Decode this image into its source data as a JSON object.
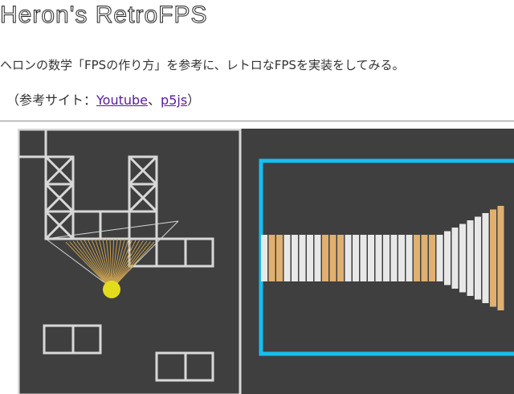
{
  "page": {
    "title": "Heron's RetroFPS",
    "description": "ヘロンの数学「FPSの作り方」を参考に、レトロなFPSを実装をしてみる。",
    "refs_prefix": "（参考サイト：",
    "refs_link1": "Youtube",
    "refs_sep": "、",
    "refs_link2": "p5js",
    "refs_suffix": "）"
  },
  "colors": {
    "background": "#ffffff",
    "canvas": "#3f3f3f",
    "wall": "#d8d8d8",
    "player": "#e2dc1c",
    "rays": "#c8a050",
    "wall_shade": "#e8e8e8",
    "wall_accent": "#e0b070",
    "viewport_border": "#14bff0",
    "link": "#5a1a9e"
  },
  "map": {
    "player_icon": "player-dot"
  },
  "view3d": {
    "strips": [
      "gray",
      "tan",
      "tan",
      "gray",
      "gray",
      "gray",
      "gray",
      "gray",
      "tan",
      "tan",
      "tan",
      "gray",
      "gray",
      "gray",
      "gray",
      "gray",
      "gray",
      "gray",
      "gray",
      "gray",
      "tan",
      "tan",
      "tan",
      "gray",
      "gray",
      "gray",
      "gray",
      "gray",
      "gray",
      "gray",
      "tan",
      "tan"
    ]
  }
}
